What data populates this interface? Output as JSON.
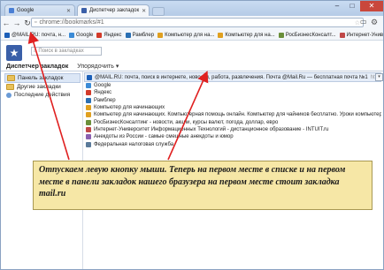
{
  "tabs": [
    {
      "label": "Google",
      "color": "#4a7fd4",
      "active": false
    },
    {
      "label": "Диспетчер закладок",
      "color": "#3a5fa8",
      "active": true
    }
  ],
  "address": {
    "url": "chrome://bookmarks/#1"
  },
  "bookmarks_bar": [
    {
      "label": "@MAIL.RU: почта, н...",
      "color": "#1b5fb8"
    },
    {
      "label": "Google",
      "color": "#3b8bd6"
    },
    {
      "label": "Яндекс",
      "color": "#d23a2a"
    },
    {
      "label": "Рамблер",
      "color": "#2a6fb3"
    },
    {
      "label": "Компьютер для на...",
      "color": "#e0a020"
    },
    {
      "label": "Компьютер для на...",
      "color": "#e0a020"
    },
    {
      "label": "РосБизнесКонсалт...",
      "color": "#6a8f3a"
    },
    {
      "label": "Интернет-Униве...",
      "color": "#c04848"
    },
    {
      "label": "Анекдоты из ...",
      "color": "#8a5fb0"
    }
  ],
  "search": {
    "placeholder": "Поиск в закладках"
  },
  "manager": {
    "title": "Диспетчер закладок",
    "organize": "Упорядочить ▾"
  },
  "tree": [
    {
      "label": "Панель закладок",
      "type": "folder",
      "selected": true
    },
    {
      "label": "Другие закладки",
      "type": "folder",
      "selected": false
    },
    {
      "label": "Последние действия",
      "type": "recent",
      "selected": false
    }
  ],
  "list": [
    {
      "title": "@MAIL.RU: почта, поиск в интернете, новости, работа, развлечения. Почта @Mail.Ru — бесплатная почта №1",
      "url": "http://mail.ru/",
      "color": "#1b5fb8",
      "selected": true
    },
    {
      "title": "Google",
      "url": "",
      "color": "#3b8bd6",
      "selected": false
    },
    {
      "title": "Яндекс",
      "url": "",
      "color": "#d23a2a",
      "selected": false
    },
    {
      "title": "Рамблер",
      "url": "",
      "color": "#2a6fb3",
      "selected": false
    },
    {
      "title": "Компьютер для начинающих",
      "url": "",
      "color": "#e0a020",
      "selected": false
    },
    {
      "title": "Компьютер для начинающих. Компьютерная помощь онлайн. Компьютер для чайников бесплатно. Уроки компьютер...",
      "url": "",
      "color": "#e0a020",
      "selected": false
    },
    {
      "title": "РосБизнесКонсалтинг - новости, акции, курсы валют, погода, доллар, евро",
      "url": "",
      "color": "#6a8f3a",
      "selected": false
    },
    {
      "title": "Интернет-Университет Информационных Технологий - дистанционное образование - INTUIT.ru",
      "url": "",
      "color": "#c04848",
      "selected": false
    },
    {
      "title": "Анекдоты из России - самые смешные анекдоты и юмор",
      "url": "",
      "color": "#8a5fb0",
      "selected": false
    },
    {
      "title": "Федеральная налоговая служба",
      "url": "",
      "color": "#5a7a9a",
      "selected": false
    }
  ],
  "caption": "Отпускаем левую кнопку мыши. Теперь на первом месте в списке и на первом месте в панели закладок нашего бразузера на первом месте стоит закладка mail.ru"
}
